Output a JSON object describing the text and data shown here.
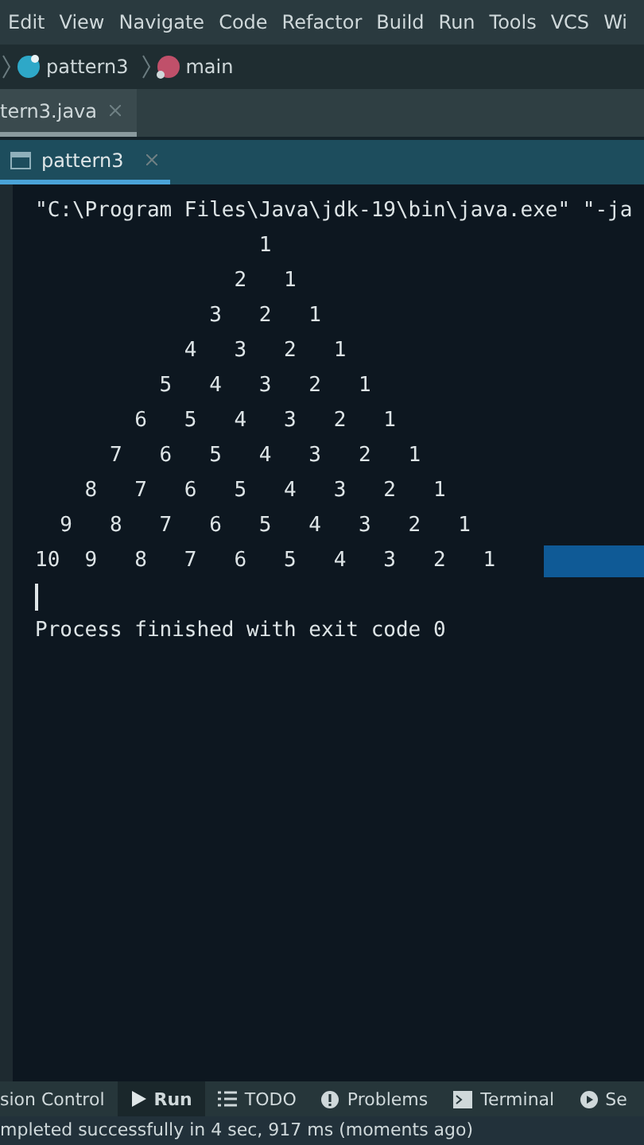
{
  "menu": [
    "Edit",
    "View",
    "Navigate",
    "Code",
    "Refactor",
    "Build",
    "Run",
    "Tools",
    "VCS",
    "Wi"
  ],
  "breadcrumb": [
    {
      "label": "pattern3",
      "kind": "class"
    },
    {
      "label": "main",
      "kind": "method"
    }
  ],
  "editor_tabs": [
    {
      "label": "tern3.java",
      "selected": true
    }
  ],
  "run_tabs": [
    {
      "label": "pattern3",
      "selected": true
    }
  ],
  "console": {
    "command": "\"C:\\Program Files\\Java\\jdk-19\\bin\\java.exe\" \"-ja",
    "output_lines": [
      "                  1",
      "                2   1",
      "              3   2   1",
      "            4   3   2   1",
      "          5   4   3   2   1",
      "        6   5   4   3   2   1",
      "      7   6   5   4   3   2   1",
      "    8   7   6   5   4   3   2   1",
      "  9   8   7   6   5   4   3   2   1",
      "10  9   8   7   6   5   4   3   2   1"
    ],
    "exit_message": "Process finished with exit code 0"
  },
  "tool_windows": [
    {
      "label": "sion Control",
      "kind": "plain",
      "selected": false
    },
    {
      "label": "Run",
      "kind": "run",
      "selected": true
    },
    {
      "label": "TODO",
      "kind": "list",
      "selected": false
    },
    {
      "label": "Problems",
      "kind": "problems",
      "selected": false
    },
    {
      "label": "Terminal",
      "kind": "terminal",
      "selected": false
    },
    {
      "label": "Se",
      "kind": "services",
      "selected": false
    }
  ],
  "status_bar": "mpleted successfully in 4 sec, 917 ms (moments ago)"
}
